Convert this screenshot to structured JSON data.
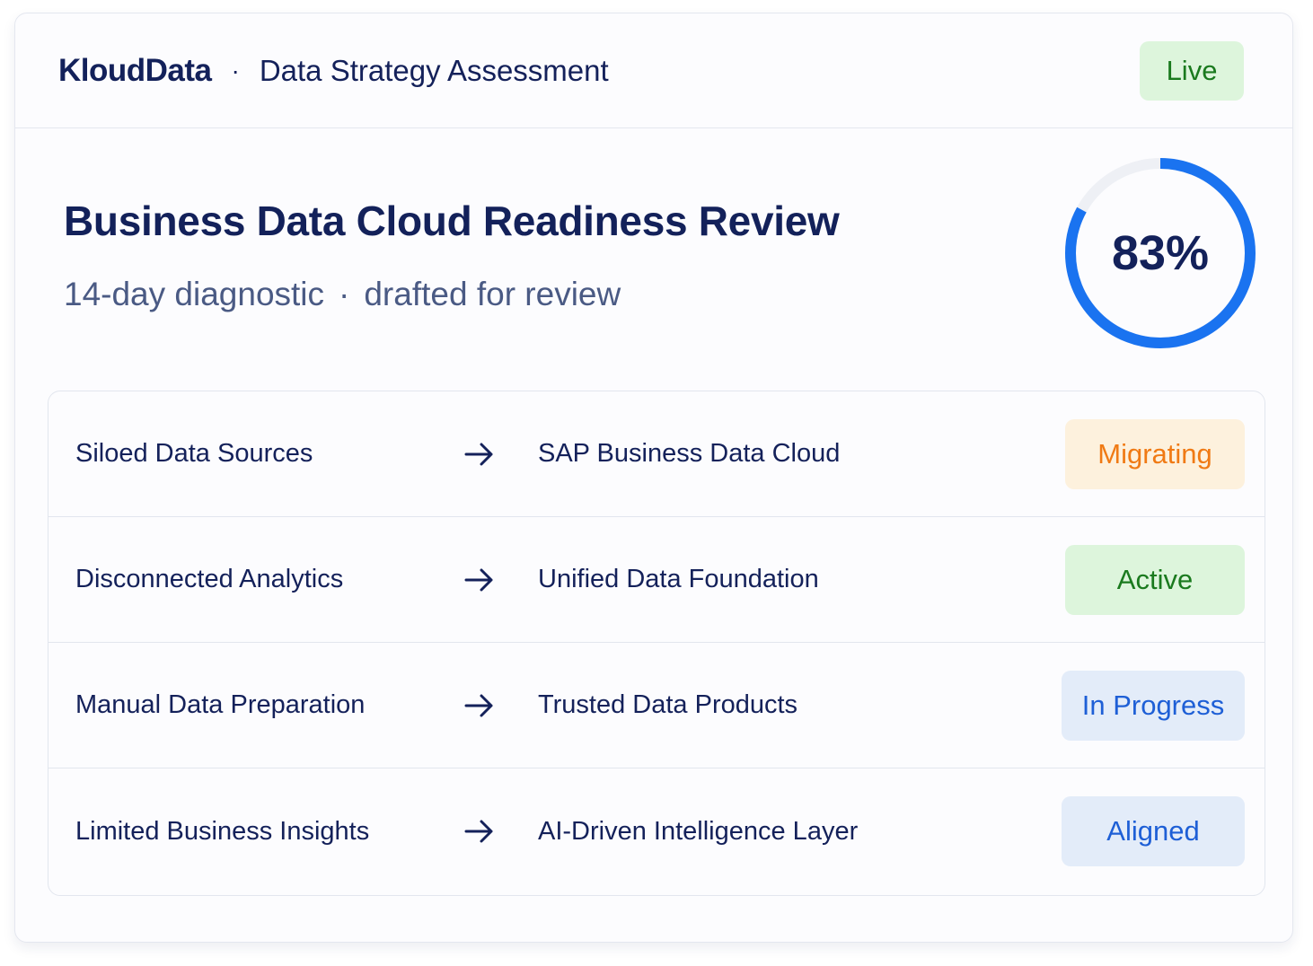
{
  "header": {
    "brand": "KloudData",
    "separator": "·",
    "section": "Data Strategy Assessment",
    "status_label": "Live"
  },
  "main": {
    "title": "Business Data Cloud Readiness Review",
    "subtitle_left": "14-day diagnostic",
    "subtitle_sep": "·",
    "subtitle_right": "drafted for review",
    "score": {
      "label": "83%",
      "fraction": 0.83,
      "color": "#1a73f0",
      "track_color": "#eef0f5"
    }
  },
  "rows": [
    {
      "from": "Siloed Data Sources",
      "to": "SAP Business Data Cloud",
      "status": "Migrating"
    },
    {
      "from": "Disconnected Analytics",
      "to": "Unified Data Foundation",
      "status": "Active"
    },
    {
      "from": "Manual Data Preparation",
      "to": "Trusted Data Products",
      "status": "In Progress"
    },
    {
      "from": "Limited Business Insights",
      "to": "AI-Driven Intelligence Layer",
      "status": "Aligned"
    }
  ],
  "icons": {
    "row_arrow": "arrow-right-icon"
  },
  "colors": {
    "navy": "#13215a",
    "live_bg": "#ddf5dc",
    "live_text": "#1a7a1e",
    "migrating_bg": "#fdf1dd",
    "migrating_text": "#f07a14",
    "blue_bg": "#e3ecf9",
    "blue_text": "#1e5fd6"
  }
}
